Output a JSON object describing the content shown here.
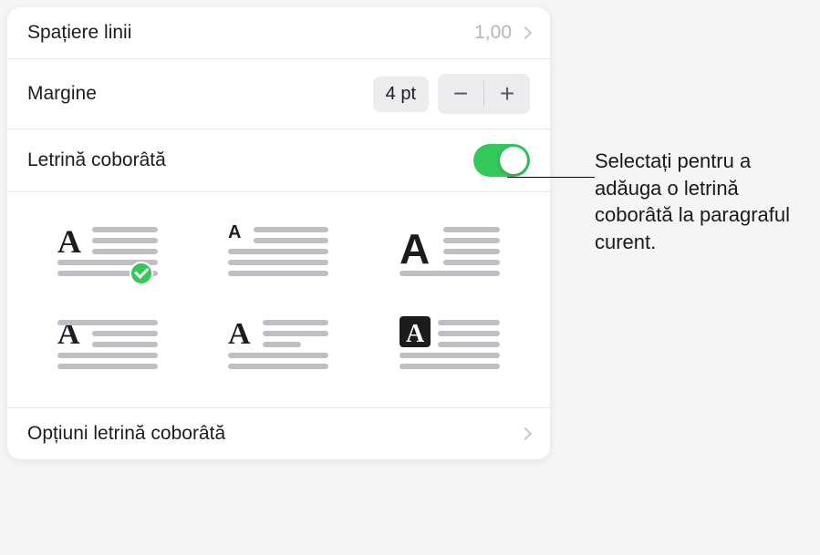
{
  "line_spacing": {
    "label": "Spațiere linii",
    "value": "1,00"
  },
  "margin": {
    "label": "Margine",
    "value": "4 pt"
  },
  "drop_cap": {
    "label": "Letrină coborâtă",
    "enabled": true,
    "selected_style": 0
  },
  "options": {
    "label": "Opțiuni letrină coborâtă"
  },
  "callout": {
    "text": "Selectați pentru a adăuga o letrină coborâtă la paragraful curent."
  },
  "colors": {
    "accent": "#34c759"
  }
}
